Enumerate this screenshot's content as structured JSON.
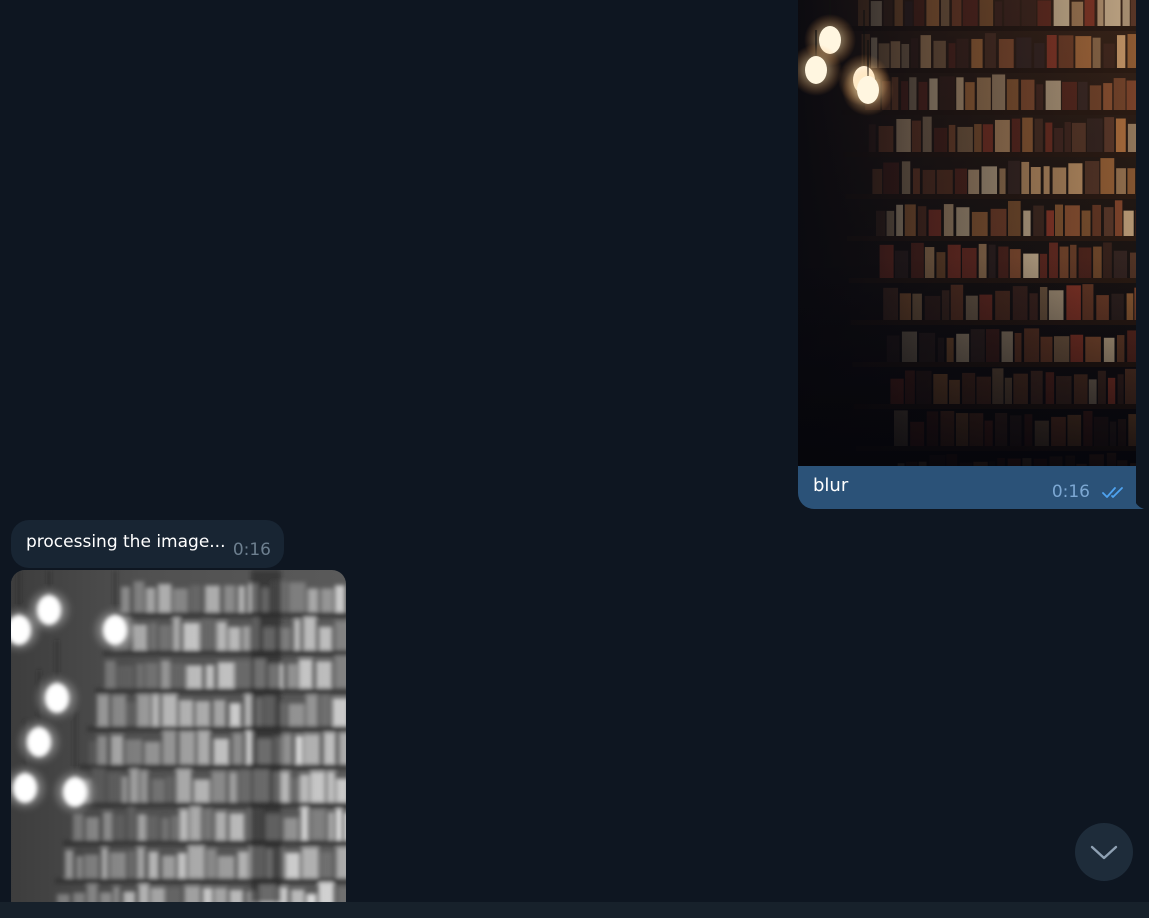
{
  "outgoing_message": {
    "caption": "blur",
    "time": "0:16",
    "status_icon": "double-check-icon"
  },
  "incoming_text_message": {
    "text": "processing the image...",
    "time": "0:16"
  },
  "incoming_photo": {
    "style": "grayscale-blurred"
  },
  "scroll_button": {
    "icon": "chevron-down-icon"
  },
  "colors": {
    "background": "#0e1621",
    "outgoing_bubble": "#2b5278",
    "incoming_bubble": "#182533",
    "time_outgoing": "#7da8d3",
    "time_incoming": "#6d7f8f",
    "check_marks": "#4fa3f0"
  }
}
